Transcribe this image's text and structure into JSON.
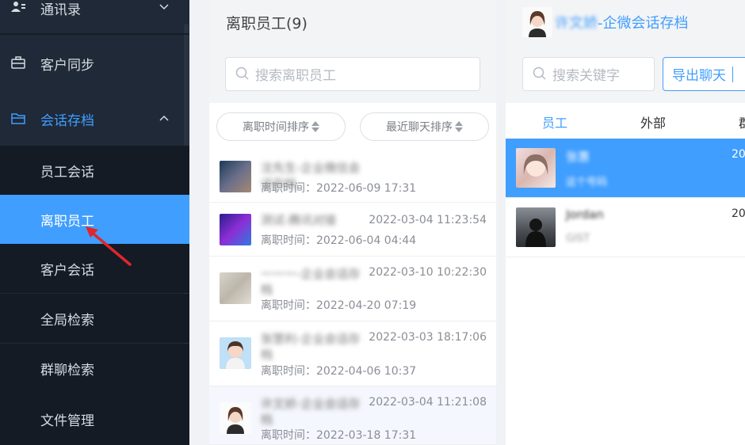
{
  "sidebar": {
    "contacts_label": "通讯录",
    "customer_sync_label": "客户同步",
    "archive_label": "会话存档",
    "sub_items": [
      {
        "label": "员工会话"
      },
      {
        "label": "离职员工"
      },
      {
        "label": "客户会话"
      },
      {
        "label": "全局检索"
      },
      {
        "label": "群聊检索"
      },
      {
        "label": "文件管理"
      }
    ]
  },
  "middle": {
    "title": "离职员工(9)",
    "search_placeholder": "搜索离职员工",
    "sort_leave_label": "离职时间排序",
    "sort_chat_label": "最近聊天排序",
    "employees": [
      {
        "name": "沈先生-企业微信会话存档",
        "last_chat": "",
        "leave": "离职时间：2022-06-09 17:31"
      },
      {
        "name": "测试-腾讯对接",
        "last_chat": "2022-03-04 11:23:54",
        "leave": "离职时间：2022-06-04 04:44"
      },
      {
        "name": "一一一-企业会话存档",
        "last_chat": "2022-03-10 10:22:30",
        "leave": "离职时间：2022-04-20 07:19"
      },
      {
        "name": "张慧利-企业会话存档",
        "last_chat": "2022-03-03 18:17:06",
        "leave": "离职时间：2022-04-06 10:37"
      },
      {
        "name": "许文娇-企业会话存档",
        "last_chat": "2022-03-04 11:21:08",
        "leave": "离职时间：2022-03-18 17:31"
      }
    ]
  },
  "right": {
    "header_name": "许文娇",
    "header_suffix": "-企微会话存档",
    "search_placeholder": "搜索关键字",
    "export_label": "导出聊天",
    "tabs": [
      "员工",
      "外部",
      "群"
    ],
    "conversations": [
      {
        "name": "张惠",
        "msg": "这个号码",
        "time": "20"
      },
      {
        "name": "Jordan",
        "msg": "GIST",
        "time": "20"
      }
    ]
  },
  "colors": {
    "accent": "#409eff",
    "sidebar_bg": "#1f2937",
    "submenu_bg": "#141b25"
  }
}
